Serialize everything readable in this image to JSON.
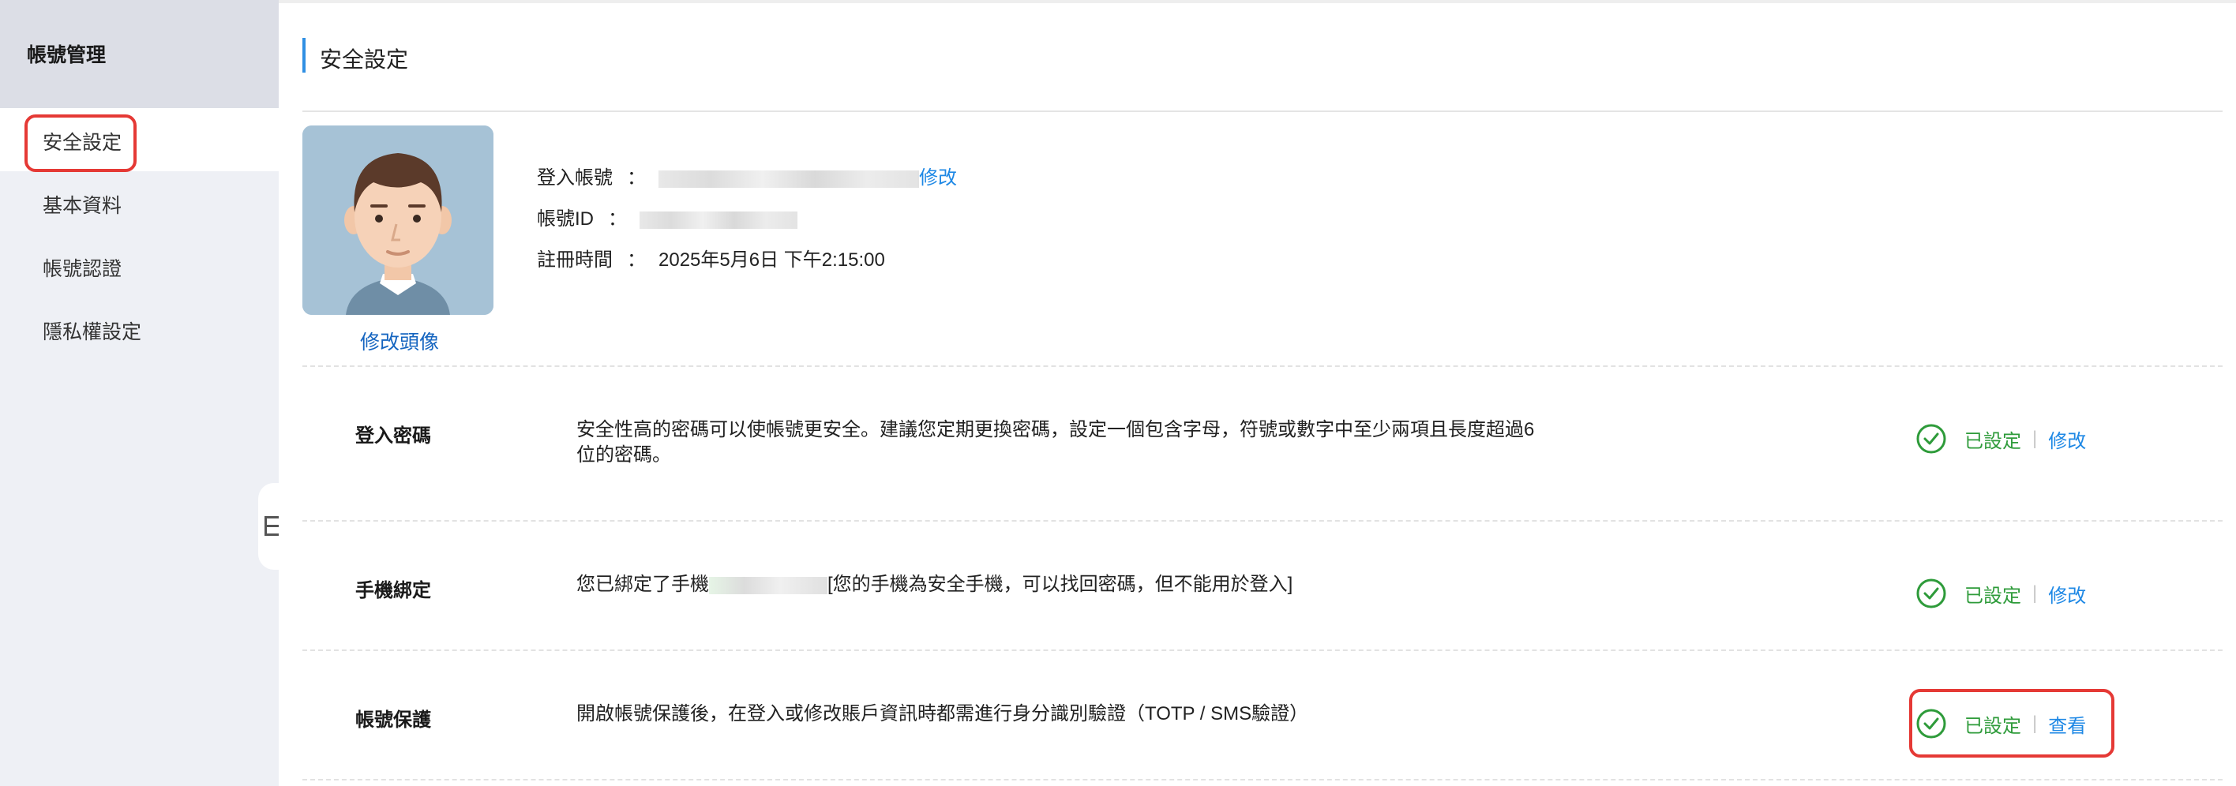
{
  "sidebar": {
    "title": "帳號管理",
    "items": [
      {
        "label": "安全設定",
        "active": true
      },
      {
        "label": "基本資料",
        "active": false
      },
      {
        "label": "帳號認證",
        "active": false
      },
      {
        "label": "隱私權設定",
        "active": false
      }
    ]
  },
  "main": {
    "title": "安全設定",
    "avatar": {
      "change_label": "修改頭像",
      "icon": "avatar-illustration"
    },
    "info": {
      "login_account_label": "登入帳號",
      "login_account_edit": "修改",
      "account_id_label": "帳號ID",
      "register_time_label": "註冊時間",
      "register_time_value": "2025年5月6日 下午2:15:00",
      "colon": "："
    },
    "rows": [
      {
        "title": "登入密碼",
        "desc_line1": "安全性高的密碼可以使帳號更安全。建議您定期更換密碼，設定一個包含字母，符號或數字中至少兩項且長度超過6",
        "desc_line2": "位的密碼。",
        "status": "已設定",
        "action": "修改"
      },
      {
        "title": "手機綁定",
        "desc_prefix": "您已綁定了手機",
        "desc_suffix": "[您的手機為安全手機，可以找回密碼，但不能用於登入]",
        "status": "已設定",
        "action": "修改"
      },
      {
        "title": "帳號保護",
        "desc": "開啟帳號保護後，在登入或修改賬戶資訊時都需進行身分識別驗證（TOTP / SMS驗證）",
        "status": "已設定",
        "action": "查看"
      }
    ],
    "separator": "|"
  },
  "colors": {
    "accent": "#1e88e5",
    "success": "#2e9b3a",
    "highlight": "#e53935",
    "sidebar_bg": "#eef0f5"
  }
}
